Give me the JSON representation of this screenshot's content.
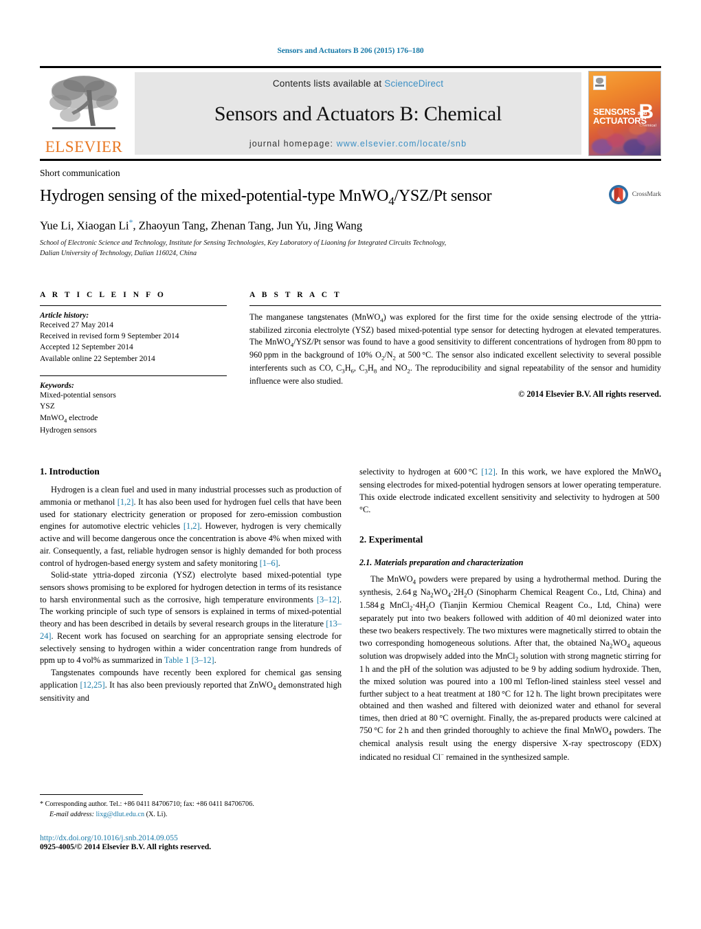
{
  "running_head": "Sensors and Actuators B 206 (2015) 176–180",
  "masthead": {
    "publisher_name": "ELSEVIER",
    "contents_prefix": "Contents lists available at ",
    "contents_link": "ScienceDirect",
    "journal_title": "Sensors and Actuators B: Chemical",
    "homepage_prefix": "journal homepage: ",
    "homepage_url": "www.elsevier.com/locate/snb",
    "cover": {
      "line1": "SENSORS",
      "line1_and": "and",
      "line2": "ACTUATORS",
      "volume_letter": "B",
      "volume_sub": "Chemical"
    }
  },
  "article": {
    "type_label": "Short communication",
    "title": "Hydrogen sensing of the mixed-potential-type MnWO4/YSZ/Pt sensor",
    "title_parts": {
      "before": "Hydrogen sensing of the mixed-potential-type MnWO",
      "sub": "4",
      "after": "/YSZ/Pt sensor"
    },
    "authors": "Yue Li, Xiaogan Li*, Zhaoyun Tang, Zhenan Tang, Jun Yu, Jing Wang",
    "authors_parts": {
      "a": "Yue Li, Xiaogan Li",
      "star": "*",
      "b": ", Zhaoyun Tang, Zhenan Tang, Jun Yu, Jing Wang"
    },
    "affiliation_line1": "School of Electronic Science and Technology, Institute for Sensing Technologies, Key Laboratory of Liaoning for Integrated Circuits Technology,",
    "affiliation_line2": "Dalian University of Technology, Dalian 116024, China",
    "crossmark_label": "CrossMark"
  },
  "article_info": {
    "heading": "A R T I C L E   I N F O",
    "history_title": "Article history:",
    "history": [
      "Received 27 May 2014",
      "Received in revised form 9 September 2014",
      "Accepted 12 September 2014",
      "Available online 22 September 2014"
    ],
    "keywords_title": "Keywords:",
    "keywords": [
      "Mixed-potential sensors",
      "YSZ",
      "MnWO4 electrode",
      "Hydrogen sensors"
    ]
  },
  "abstract": {
    "heading": "A B S T R A C T",
    "text": "The manganese tangstenates (MnWO4) was explored for the first time for the oxide sensing electrode of the yttria-stabilized zirconia electrolyte (YSZ) based mixed-potential type sensor for detecting hydrogen at elevated temperatures. The MnWO4/YSZ/Pt sensor was found to have a good sensitivity to different concentrations of hydrogen from 80 ppm to 960 ppm in the background of 10% O2/N2 at 500 °C. The sensor also indicated excellent selectivity to several possible interferents such as CO, C3H6, C3H8 and NO2. The reproducibility and signal repeatability of the sensor and humidity influence were also studied.",
    "copyright": "© 2014 Elsevier B.V. All rights reserved."
  },
  "sections": {
    "intro_heading": "1.  Introduction",
    "intro_p1": "Hydrogen is a clean fuel and used in many industrial processes such as production of ammonia or methanol [1,2]. It has also been used for hydrogen fuel cells that have been used for stationary electricity generation or proposed for zero-emission combustion engines for automotive electric vehicles [1,2]. However, hydrogen is very chemically active and will become dangerous once the concentration is above 4% when mixed with air. Consequently, a fast, reliable hydrogen sensor is highly demanded for both process control of hydrogen-based energy system and safety monitoring [1–6].",
    "intro_p2": "Solid-state yttria-doped zirconia (YSZ) electrolyte based mixed-potential type sensors shows promising to be explored for hydrogen detection in terms of its resistance to harsh environmental such as the corrosive, high temperature environments [3–12]. The working principle of such type of sensors is explained in terms of mixed-potential theory and has been described in details by several research groups in the literature [13–24]. Recent work has focused on searching for an appropriate sensing electrode for selectively sensing to hydrogen within a wider concentration range from hundreds of ppm up to 4 vol% as summarized in Table 1 [3–12].",
    "intro_p3": "Tangstenates compounds have recently been explored for chemical gas sensing application [12,25]. It has also been previously reported that ZnWO4 demonstrated high sensitivity and",
    "intro_p4": "selectivity to hydrogen at 600 °C [12]. In this work, we have explored the MnWO4 sensing electrodes for mixed-potential hydrogen sensors at lower operating temperature. This oxide electrode indicated excellent sensitivity and selectivity to hydrogen at 500 °C.",
    "exp_heading": "2.  Experimental",
    "exp_sub_heading": "2.1.  Materials preparation and characterization",
    "exp_p1": "The MnWO4 powders were prepared by using a hydrothermal method. During the synthesis, 2.64 g Na2WO4·2H2O (Sinopharm Chemical Reagent Co., Ltd, China) and 1.584 g MnCl2·4H2O (Tianjin Kermiou Chemical Reagent Co., Ltd, China) were separately put into two beakers followed with addition of 40 ml deionized water into these two beakers respectively. The two mixtures were magnetically stirred to obtain the two corresponding homogeneous solutions. After that, the obtained Na2WO4 aqueous solution was dropwisely added into the MnCl2 solution with strong magnetic stirring for 1 h and the pH of the solution was adjusted to be 9 by adding sodium hydroxide. Then, the mixed solution was poured into a 100 ml Teflon-lined stainless steel vessel and further subject to a heat treatment at 180 °C for 12 h. The light brown precipitates were obtained and then washed and filtered with deionized water and ethanol for several times, then dried at 80 °C overnight. Finally, the as-prepared products were calcined at 750 °C for 2 h and then grinded thoroughly to achieve the final MnWO4 powders. The chemical analysis result using the energy dispersive X-ray spectroscopy (EDX) indicated no residual Cl− remained in the synthesized sample."
  },
  "footnote": {
    "star": "*",
    "corresponding": "Corresponding author. Tel.: +86 0411 84706710; fax: +86 0411 84706706.",
    "email_label": "E-mail address:",
    "email": "lixg@dlut.edu.cn",
    "email_suffix": "(X. Li)."
  },
  "footer": {
    "doi": "http://dx.doi.org/10.1016/j.snb.2014.09.055",
    "issn": "0925-4005/© 2014 Elsevier B.V. All rights reserved."
  },
  "colors": {
    "link_blue": "#1a7aa8",
    "sciencedirect_blue": "#3b8fc4",
    "elsevier_orange": "#E87722",
    "panel_gray": "#e6e6e6"
  }
}
